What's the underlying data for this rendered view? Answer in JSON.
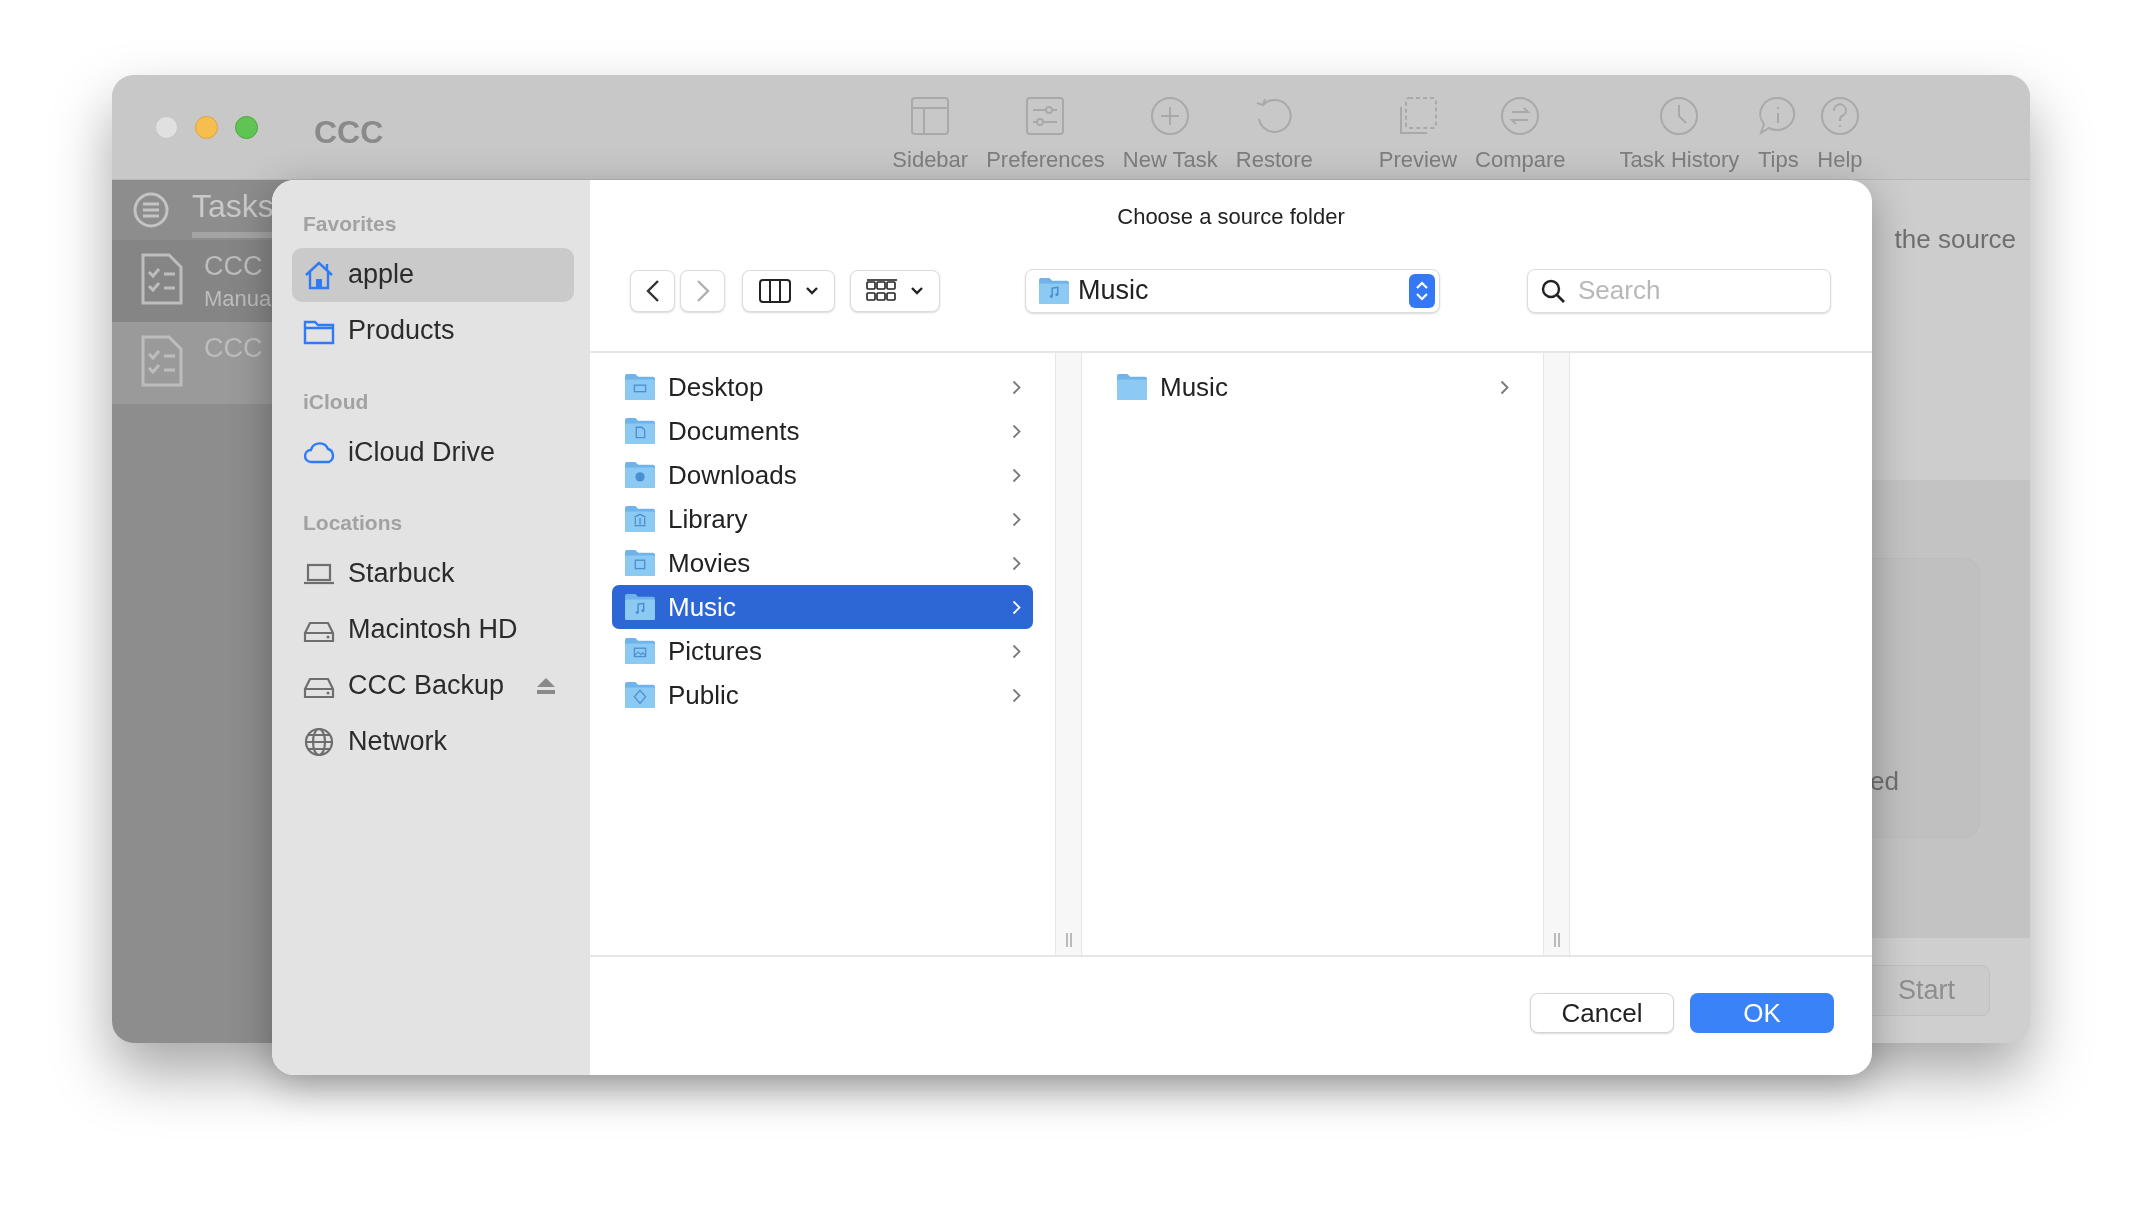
{
  "window": {
    "title": "CCC"
  },
  "toolbar": [
    {
      "label": "Sidebar"
    },
    {
      "label": "Preferences"
    },
    {
      "label": "New Task"
    },
    {
      "label": "Restore"
    },
    {
      "label": "Preview"
    },
    {
      "label": "Compare"
    },
    {
      "label": "Task History"
    },
    {
      "label": "Tips"
    },
    {
      "label": "Help"
    }
  ],
  "task_sidebar": {
    "title": "Tasks",
    "tasks": [
      {
        "name": "CCC",
        "subtitle": "Manua",
        "selected": false
      },
      {
        "name": "CCC",
        "selected": true
      }
    ]
  },
  "background_text": [
    "the source",
    "ed"
  ],
  "start_button": "Start",
  "dialog": {
    "title": "Choose a source folder",
    "sidebar": [
      {
        "heading": "Favorites",
        "items": [
          {
            "label": "apple",
            "kind": "home",
            "selected": true,
            "ejectable": false
          },
          {
            "label": "Products",
            "kind": "folder",
            "selected": false,
            "ejectable": false
          }
        ]
      },
      {
        "heading": "iCloud",
        "items": [
          {
            "label": "iCloud Drive",
            "kind": "cloud",
            "selected": false,
            "ejectable": false
          }
        ]
      },
      {
        "heading": "Locations",
        "items": [
          {
            "label": "Starbuck",
            "kind": "laptop",
            "selected": false,
            "ejectable": false
          },
          {
            "label": "Macintosh HD",
            "kind": "disk",
            "selected": false,
            "ejectable": false
          },
          {
            "label": "CCC Backup",
            "kind": "disk",
            "selected": false,
            "ejectable": true
          },
          {
            "label": "Network",
            "kind": "network",
            "selected": false,
            "ejectable": false
          }
        ]
      }
    ],
    "path_popup": "Music",
    "search": {
      "placeholder": "Search"
    },
    "columns": [
      [
        {
          "name": "Desktop",
          "kind": "desktop",
          "selected": false
        },
        {
          "name": "Documents",
          "kind": "documents",
          "selected": false
        },
        {
          "name": "Downloads",
          "kind": "downloads",
          "selected": false
        },
        {
          "name": "Library",
          "kind": "library",
          "selected": false
        },
        {
          "name": "Movies",
          "kind": "movies",
          "selected": false
        },
        {
          "name": "Music",
          "kind": "music",
          "selected": true
        },
        {
          "name": "Pictures",
          "kind": "pictures",
          "selected": false
        },
        {
          "name": "Public",
          "kind": "public",
          "selected": false
        }
      ],
      [
        {
          "name": "Music",
          "kind": "plain",
          "selected": false
        }
      ]
    ],
    "buttons": {
      "cancel": "Cancel",
      "ok": "OK"
    }
  }
}
